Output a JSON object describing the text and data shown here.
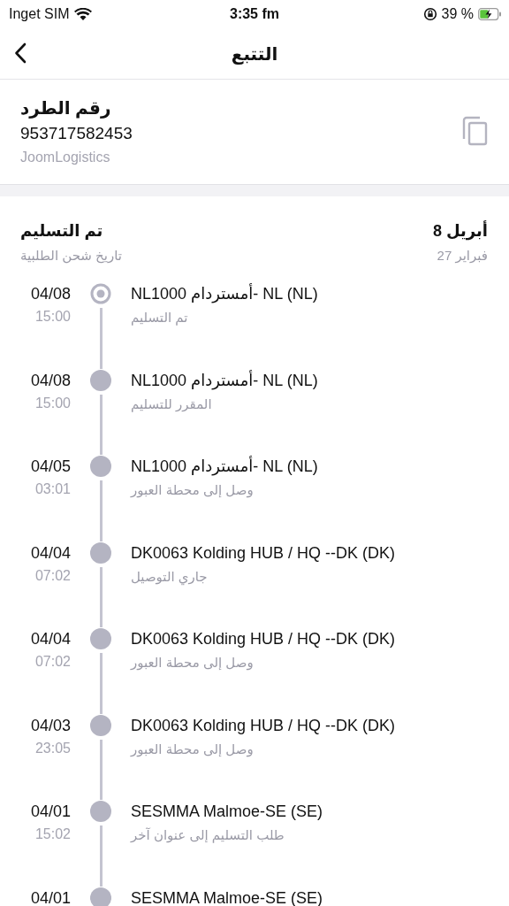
{
  "status_bar": {
    "carrier": "Inget SIM",
    "time": "3:35 fm",
    "battery": "39 %"
  },
  "nav": {
    "title": "التتبع"
  },
  "parcel": {
    "label": "رقم الطرد",
    "number": "953717582453",
    "carrier": "JoomLogistics"
  },
  "summary": {
    "status": "تم التسليم",
    "date": "8 أبريل",
    "shipped_label": "تاريخ شحن الطلبية",
    "shipped_date": "27 فبراير"
  },
  "events": [
    {
      "kind": "current",
      "date": "04/08",
      "time": "15:00",
      "place": "NL1000 أمستردام- NL (NL)",
      "status": "تم التسليم"
    },
    {
      "kind": "past",
      "date": "04/08",
      "time": "15:00",
      "place": "NL1000 أمستردام- NL (NL)",
      "status": "المقرر للتسليم"
    },
    {
      "kind": "past",
      "date": "04/05",
      "time": "03:01",
      "place": "NL1000 أمستردام- NL (NL)",
      "status": "وصل إلى محطة العبور"
    },
    {
      "kind": "past",
      "date": "04/04",
      "time": "07:02",
      "place": "DK0063 Kolding HUB / HQ --DK (DK)",
      "status": "جاري التوصيل"
    },
    {
      "kind": "past",
      "date": "04/04",
      "time": "07:02",
      "place": "DK0063 Kolding HUB / HQ --DK (DK)",
      "status": "وصل إلى محطة العبور"
    },
    {
      "kind": "past",
      "date": "04/03",
      "time": "23:05",
      "place": "DK0063 Kolding HUB / HQ --DK (DK)",
      "status": "وصل إلى محطة العبور"
    },
    {
      "kind": "past",
      "date": "04/01",
      "time": "15:02",
      "place": "SESMMA Malmoe-SE (SE)",
      "status": "طلب التسليم إلى عنوان آخر"
    },
    {
      "kind": "past",
      "date": "04/01",
      "place": "SESMMA Malmoe-SE (SE)"
    }
  ]
}
